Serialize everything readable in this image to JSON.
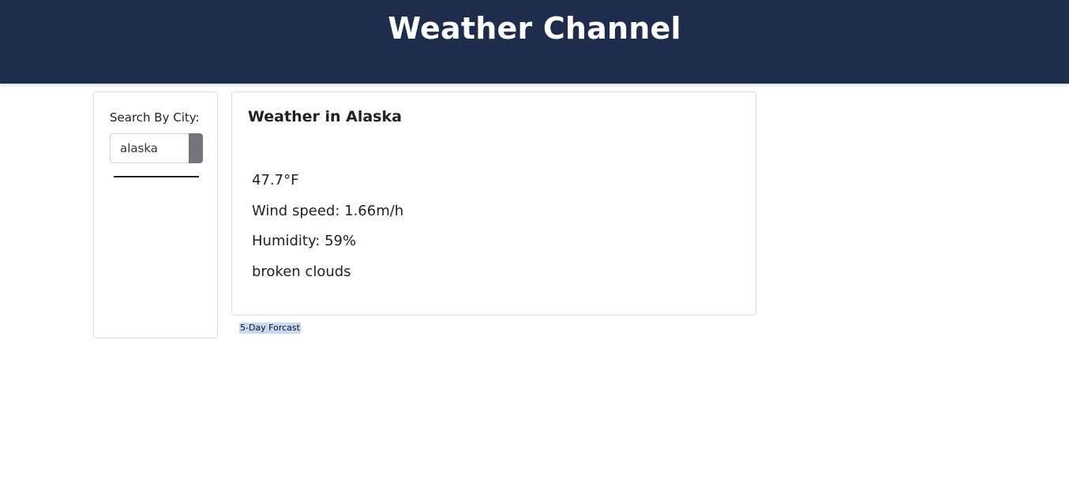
{
  "header": {
    "title": "Weather Channel"
  },
  "sidebar": {
    "search_label": "Search By City:",
    "search_value": "alaska",
    "search_button_label": ""
  },
  "weather": {
    "title": "Weather in Alaska",
    "temperature": "47.7°F",
    "wind_speed": "Wind speed: 1.66m/h",
    "humidity": "Humidity: 59%",
    "description": "broken clouds"
  },
  "forecast": {
    "label": "5-Day Forcast"
  },
  "colors": {
    "header_bg": "#1f2d4d",
    "button_bg": "#72757d",
    "selection_bg": "#c6d9f7"
  }
}
